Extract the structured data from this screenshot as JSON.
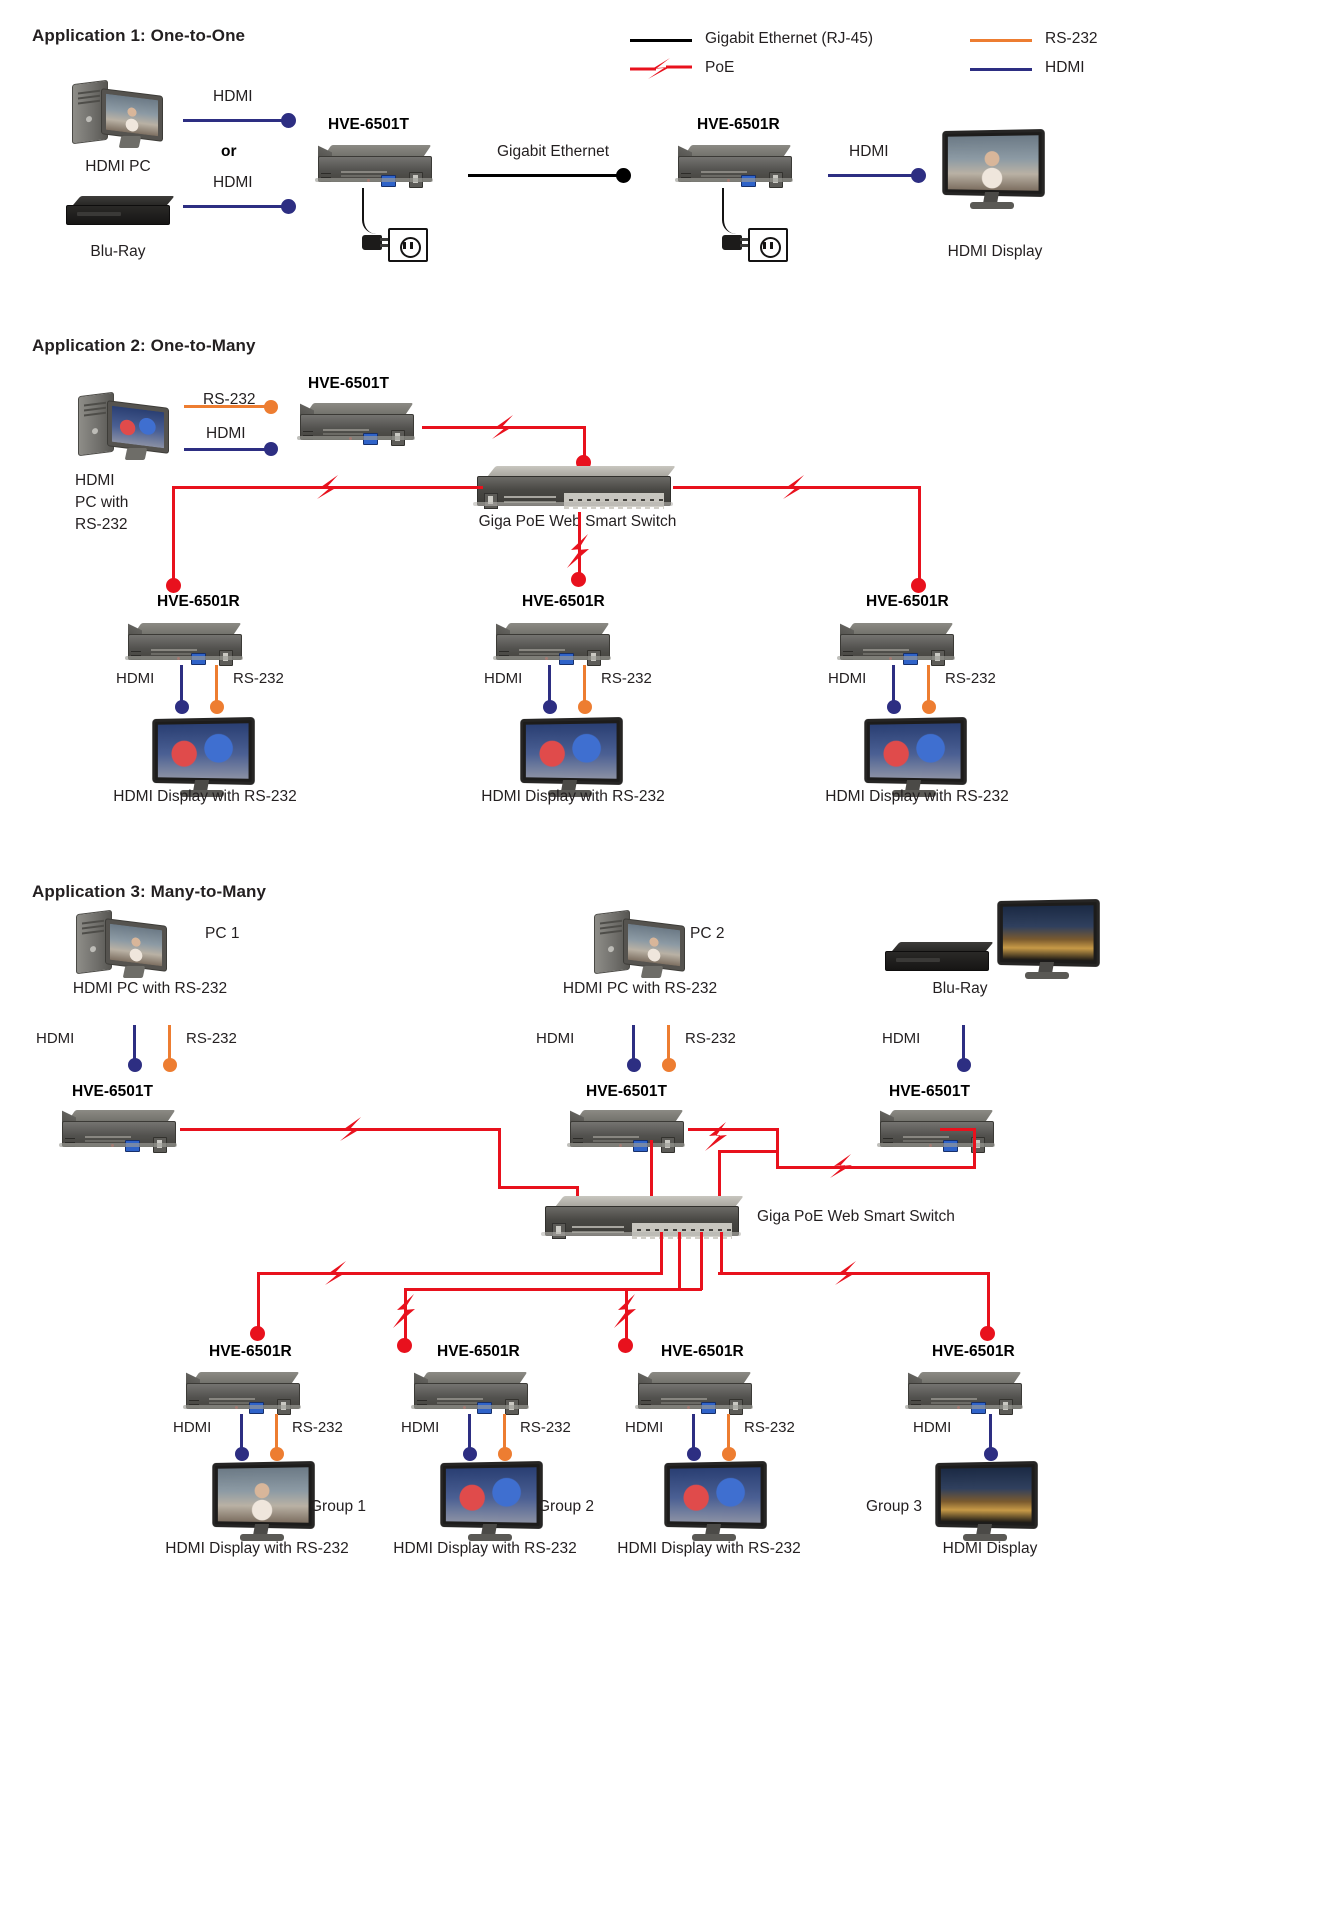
{
  "legend": {
    "items": [
      {
        "label": "Gigabit Ethernet (RJ-45)",
        "type": "line",
        "color": "#000000"
      },
      {
        "label": "PoE",
        "type": "bolt",
        "color": "#e8111d"
      },
      {
        "label": "RS-232",
        "type": "line",
        "color": "#ed7d31"
      },
      {
        "label": "HDMI",
        "type": "line",
        "color": "#2d2e82"
      }
    ]
  },
  "colors": {
    "hdmi": "#2d2e82",
    "rs232": "#ed7d31",
    "ethernet": "#000000",
    "poe": "#e8111d",
    "text": "#231f20"
  },
  "app1": {
    "title": "Application 1: One-to-One",
    "src_pc_label": "HDMI PC",
    "src_bluray_label": "Blu-Ray",
    "link_hdmi_top": "HDMI",
    "or_label": "or",
    "link_hdmi_bottom": "HDMI",
    "transmitter": "HVE-6501T",
    "trunk_label": "Gigabit Ethernet",
    "receiver": "HVE-6501R",
    "link_hdmi_out": "HDMI",
    "display_label": "HDMI Display"
  },
  "app2": {
    "title": "Application 2: One-to-Many",
    "source_label_l1": "HDMI",
    "source_label_l2": "PC with",
    "source_label_l3": "RS-232",
    "link_rs232": "RS-232",
    "link_hdmi": "HDMI",
    "transmitter": "HVE-6501T",
    "switch_label": "Giga PoE Web Smart Switch",
    "receivers": [
      {
        "name": "HVE-6501R",
        "out_hdmi": "HDMI",
        "out_rs232": "RS-232",
        "display": "HDMI Display with RS-232"
      },
      {
        "name": "HVE-6501R",
        "out_hdmi": "HDMI",
        "out_rs232": "RS-232",
        "display": "HDMI Display with RS-232"
      },
      {
        "name": "HVE-6501R",
        "out_hdmi": "HDMI",
        "out_rs232": "RS-232",
        "display": "HDMI Display with RS-232"
      }
    ]
  },
  "app3": {
    "title": "Application 3:  Many-to-Many",
    "switch_label": "Giga PoE Web Smart Switch",
    "sources": [
      {
        "badge": "PC 1",
        "caption": "HDMI PC with RS-232",
        "link_hdmi": "HDMI",
        "link_rs232": "RS-232",
        "device": "HVE-6501T"
      },
      {
        "badge": "PC 2",
        "caption": "HDMI PC with RS-232",
        "link_hdmi": "HDMI",
        "link_rs232": "RS-232",
        "device": "HVE-6501T"
      },
      {
        "badge": "",
        "caption": "Blu-Ray",
        "link_hdmi": "HDMI",
        "link_rs232": "",
        "device": "HVE-6501T"
      }
    ],
    "receivers": [
      {
        "name": "HVE-6501R",
        "out_hdmi": "HDMI",
        "out_rs232": "RS-232",
        "group": "Group 1",
        "display": "HDMI Display with RS-232"
      },
      {
        "name": "HVE-6501R",
        "out_hdmi": "HDMI",
        "out_rs232": "RS-232",
        "group": "",
        "display": "HDMI Display with RS-232"
      },
      {
        "name": "HVE-6501R",
        "out_hdmi": "HDMI",
        "out_rs232": "RS-232",
        "group": "Group 2",
        "display": "HDMI Display with RS-232"
      },
      {
        "name": "HVE-6501R",
        "out_hdmi": "HDMI",
        "out_rs232": "",
        "group": "Group 3",
        "display": "HDMI Display"
      }
    ]
  }
}
